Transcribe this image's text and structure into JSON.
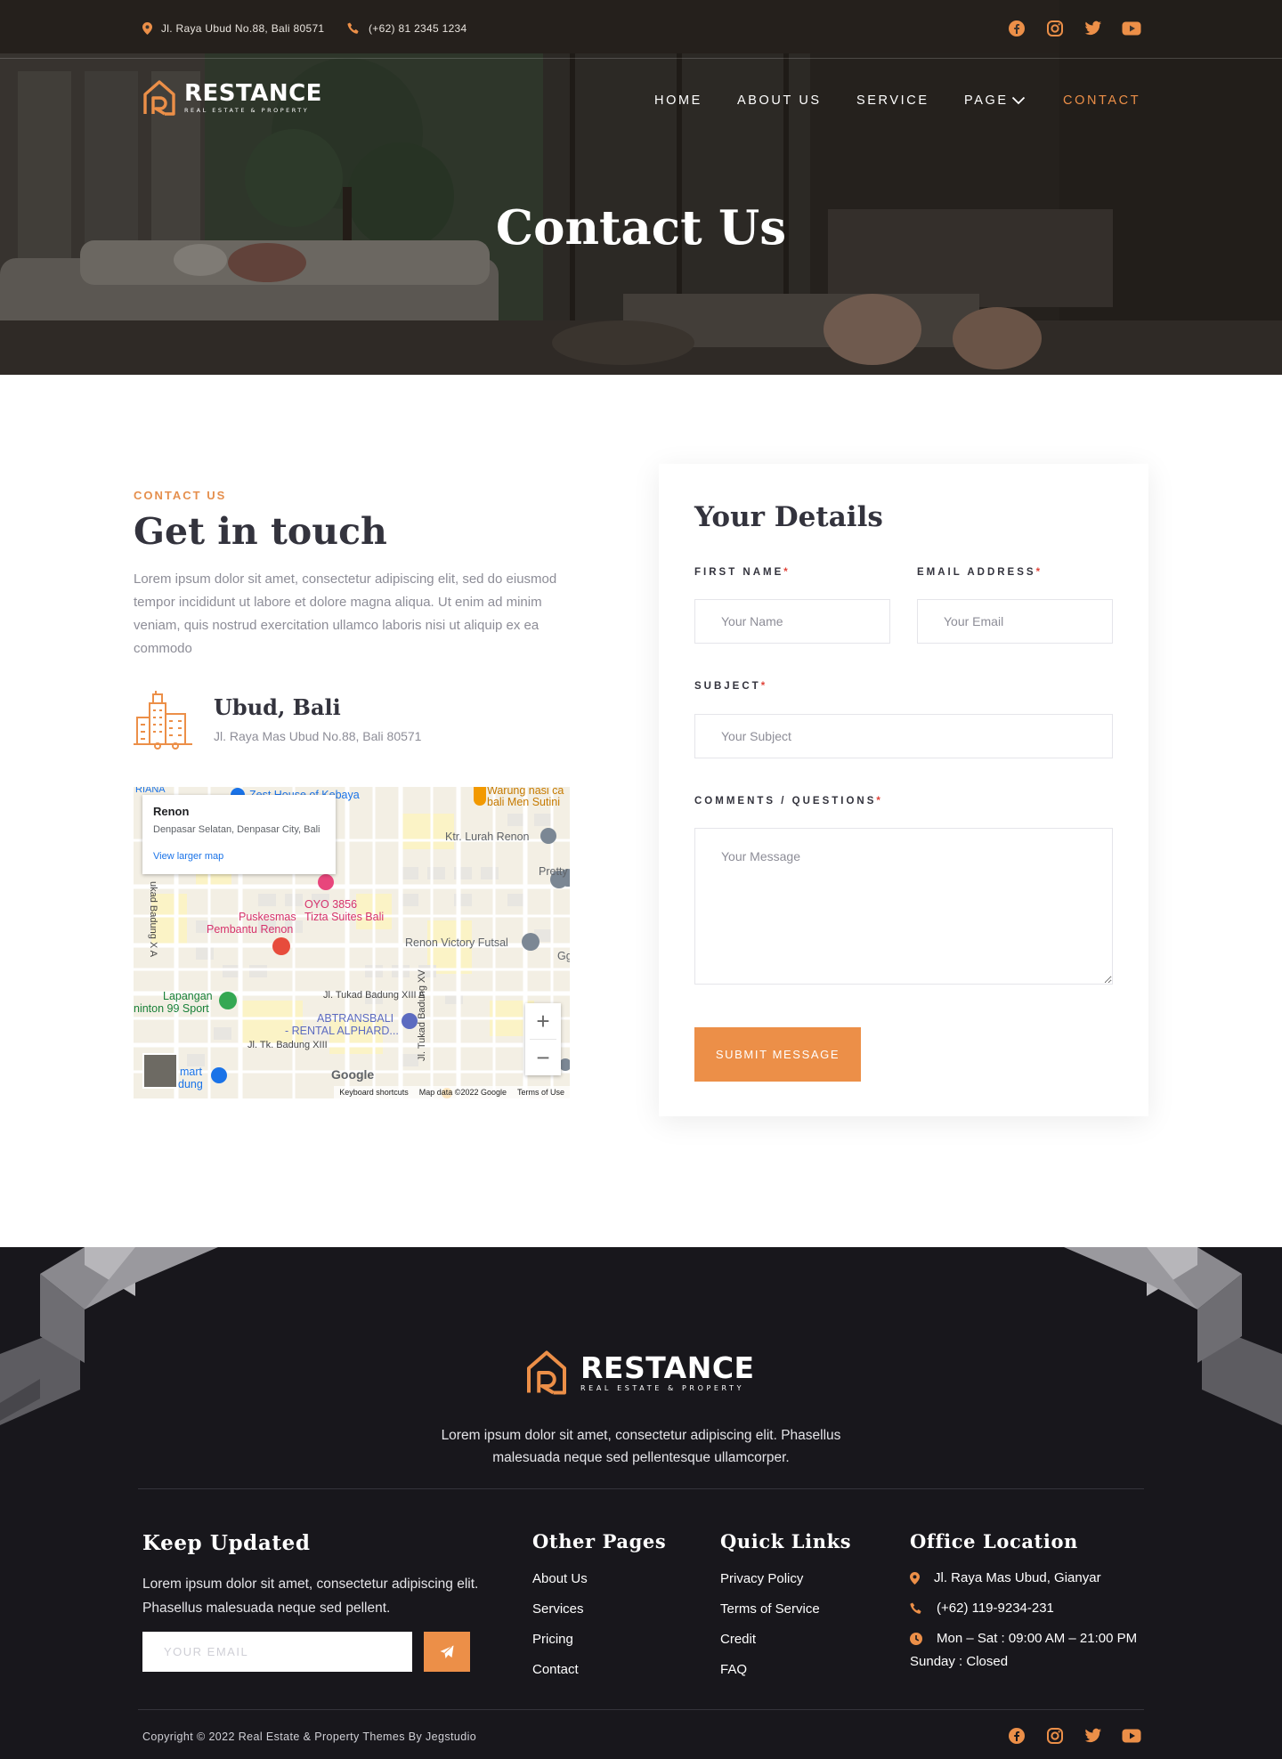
{
  "topbar": {
    "address": "Jl. Raya Ubud No.88, Bali 80571",
    "phone": "(+62) 81 2345 1234",
    "social": [
      "facebook-icon",
      "instagram-icon",
      "twitter-icon",
      "youtube-icon"
    ]
  },
  "brand": {
    "name": "RESTANCE",
    "tagline": "REAL ESTATE & PROPERTY",
    "accent": "#ec8f48"
  },
  "nav": {
    "items": [
      {
        "label": "HOME"
      },
      {
        "label": "ABOUT US"
      },
      {
        "label": "SERVICE"
      },
      {
        "label": "PAGE"
      },
      {
        "label": "CONTACT"
      }
    ],
    "active": "CONTACT"
  },
  "hero": {
    "title": "Contact Us"
  },
  "contact": {
    "eyebrow": "CONTACT US",
    "title": "Get in touch",
    "lead": "Lorem ipsum dolor sit amet, consectetur adipiscing elit, sed do eiusmod tempor incididunt ut labore et dolore magna aliqua. Ut enim ad minim veniam, quis nostrud exercitation ullamco laboris nisi ut aliquip ex ea commodo",
    "location_title": "Ubud, Bali",
    "location_address": "Jl. Raya Mas Ubud No.88, Bali 80571"
  },
  "map": {
    "place_title": "Renon",
    "place_subtitle": "Denpasar Selatan, Denpasar City, Bali",
    "larger_map_link": "View larger map",
    "labels": [
      "RIANA",
      "Zest House of Kebaya",
      "Warung nasi ca",
      "bali Men Sutini",
      "Ktr. Lurah Renon",
      "Pretty",
      "OYO 3856",
      "Tizta Suites Bali",
      "Puskesmas",
      "Pembantu Renon",
      "Renon Victory Futsal",
      "Gg",
      "Lapangan",
      "ninton 99 Sport",
      "Jl. Tukad Badung XIII A",
      "ABTRANSBALI",
      "- RENTAL ALPHARD...",
      "Jl. Tk. Badung XIII",
      "Jl. Tukad Badung XV",
      "ukad Badung X A",
      "mart",
      "dung",
      "Google"
    ],
    "zoom_in": "+",
    "zoom_out": "−",
    "footer": [
      "Keyboard shortcuts",
      "Map data ©2022 Google",
      "Terms of Use"
    ]
  },
  "form": {
    "title": "Your Details",
    "first_name_label": "FIRST NAME",
    "first_name_placeholder": "Your Name",
    "email_label": "EMAIL ADDRESS",
    "email_placeholder": "Your Email",
    "subject_label": "SUBJECT",
    "subject_placeholder": "Your Subject",
    "comments_label": "COMMENTS / QUESTIONS",
    "comments_placeholder": "Your Message",
    "required_mark": "*",
    "submit_label": "SUBMIT MESSAGE"
  },
  "footer": {
    "description": "Lorem ipsum dolor sit amet, consectetur adipiscing elit. Phasellus malesuada neque sed pellentesque ullamcorper.",
    "keep_updated": {
      "title": "Keep Updated",
      "text": "Lorem ipsum dolor sit amet, consectetur adipiscing elit. Phasellus malesuada neque sed pellent.",
      "email_placeholder": "YOUR EMAIL"
    },
    "other_pages": {
      "title": "Other Pages",
      "links": [
        "About Us",
        "Services",
        "Pricing",
        "Contact"
      ]
    },
    "quick_links": {
      "title": "Quick Links",
      "links": [
        "Privacy Policy",
        "Terms of Service",
        "Credit",
        "FAQ"
      ]
    },
    "office": {
      "title": "Office Location",
      "address": "Jl. Raya Mas Ubud, Gianyar",
      "phone": "(+62) 119-9234-231",
      "hours_weekday": "Mon – Sat : 09:00 AM – 21:00 PM",
      "hours_sunday": "Sunday : Closed"
    },
    "copyright": "Copyright © 2022 Real Estate & Property Themes By Jegstudio"
  }
}
